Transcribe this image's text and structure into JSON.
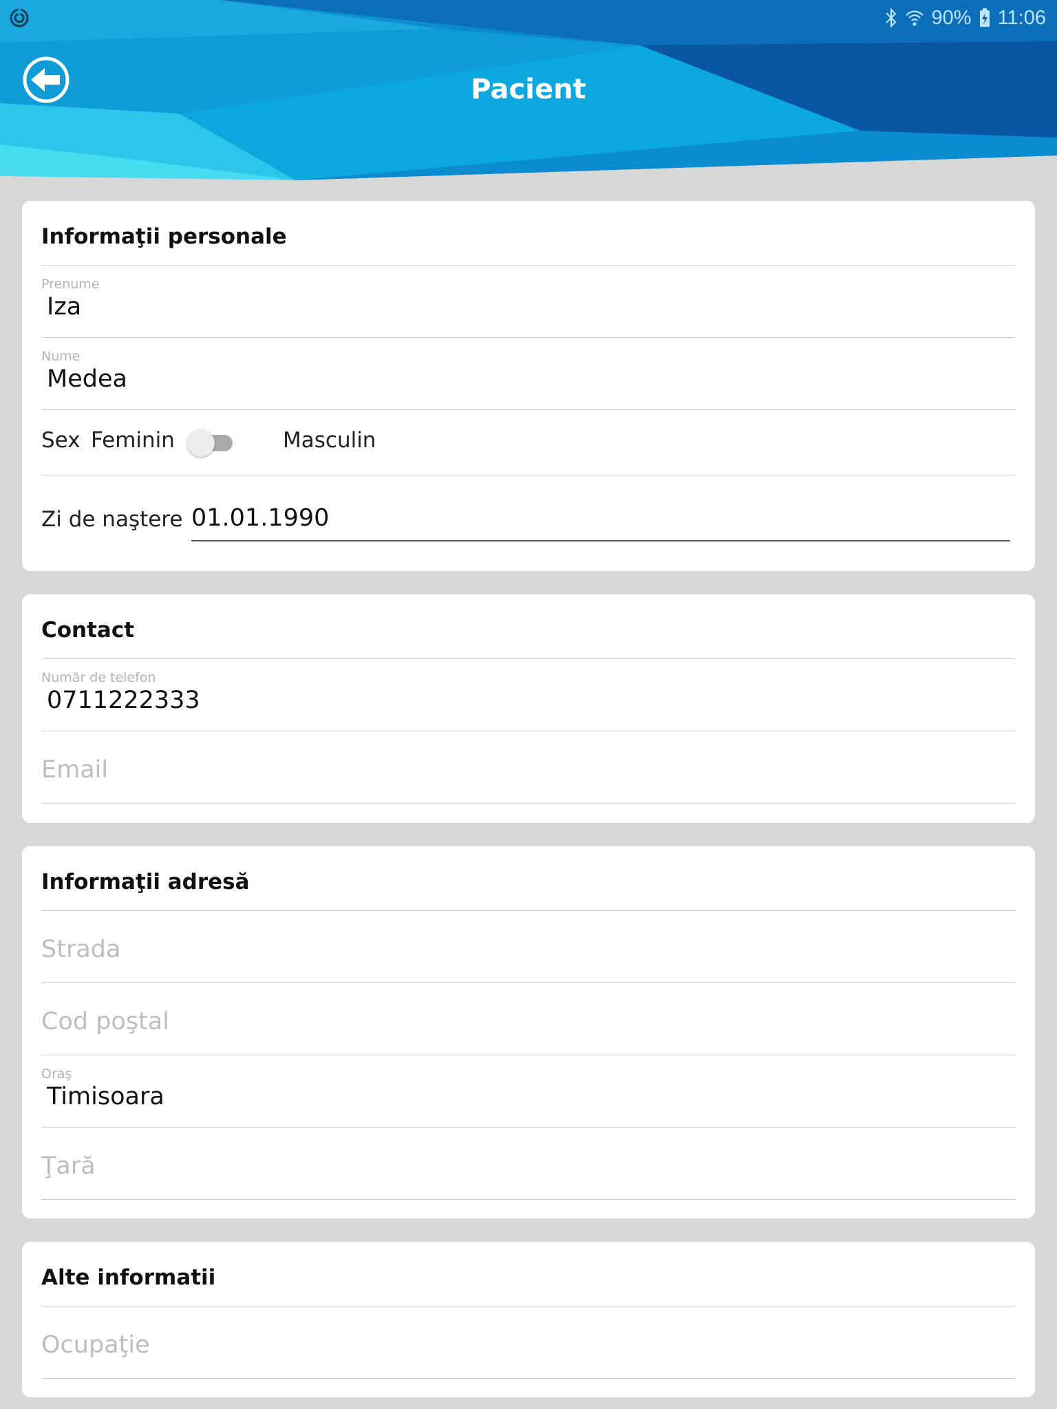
{
  "status_bar": {
    "battery": "90%",
    "time": "11:06",
    "icons": [
      "sync-icon",
      "bluetooth-icon",
      "wifi-icon",
      "battery-charging-icon"
    ]
  },
  "header": {
    "title": "Pacient",
    "back_icon": "arrow-left-circle-icon",
    "colors": {
      "primary": "#0a7fc4",
      "light": "#3fd3ef",
      "dark": "#0a4e98"
    }
  },
  "personal": {
    "title": "Informaţii personale",
    "first_name": {
      "label": "Prenume",
      "value": "Iza"
    },
    "last_name": {
      "label": "Nume",
      "value": "Medea"
    },
    "sex": {
      "label": "Sex",
      "option_left": "Feminin",
      "option_right": "Masculin",
      "selected": "Feminin"
    },
    "birthday": {
      "label": "Zi de naştere",
      "value": "01.01.1990"
    }
  },
  "contact": {
    "title": "Contact",
    "phone": {
      "label": "Număr de telefon",
      "value": "0711222333"
    },
    "email": {
      "placeholder": "Email"
    }
  },
  "address": {
    "title": "Informaţii adresă",
    "street": {
      "placeholder": "Strada"
    },
    "postal_code": {
      "placeholder": "Cod poştal"
    },
    "city": {
      "label": "Oraş",
      "value": "Timisoara"
    },
    "country": {
      "placeholder": "Ţară"
    }
  },
  "other": {
    "title": "Alte informatii",
    "occupation": {
      "placeholder": "Ocupaţie"
    }
  }
}
